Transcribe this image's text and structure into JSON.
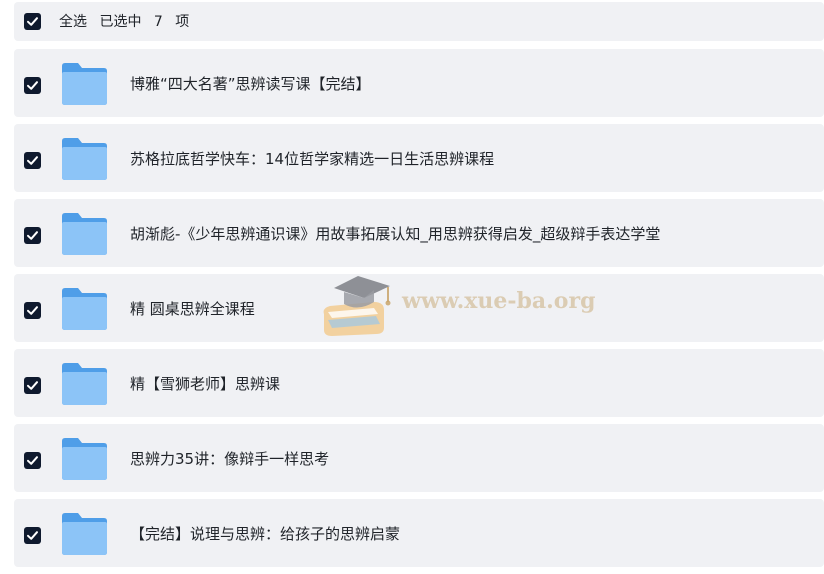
{
  "header": {
    "select_all_label": "全选",
    "selected_prefix": "已选中",
    "selected_count": "7",
    "selected_suffix": "项",
    "checked": true
  },
  "folders": [
    {
      "name": "博雅“四大名著”思辨读写课【完结】",
      "checked": true
    },
    {
      "name": "苏格拉底哲学快车：14位哲学家精选一日生活思辨课程",
      "checked": true
    },
    {
      "name": "胡渐彪-《少年思辨通识课》用故事拓展认知_用思辨获得启发_超级辩手表达学堂",
      "checked": true
    },
    {
      "name": "精 圆桌思辨全课程",
      "checked": true
    },
    {
      "name": "精【雪狮老师】思辨课",
      "checked": true
    },
    {
      "name": "思辨力35讲：像辩手一样思考",
      "checked": true
    },
    {
      "name": "【完结】说理与思辨：给孩子的思辨启蒙",
      "checked": true
    }
  ],
  "icons": {
    "checkbox": "checkbox-checked-icon",
    "folder": "folder-icon",
    "watermark_logo": "graduation-cap-book-icon"
  },
  "colors": {
    "row_background": "#f0f1f4",
    "checkbox_fill": "#0f1a2e",
    "folder_blue": "#5aa8f0",
    "text": "#1f2329"
  },
  "watermark": {
    "text": "www.xue-ba.org"
  }
}
